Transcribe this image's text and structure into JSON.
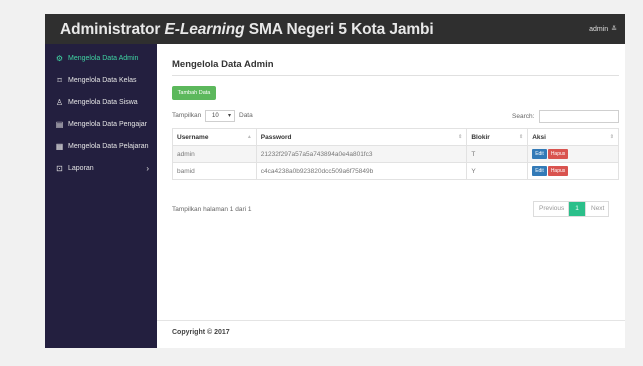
{
  "header": {
    "brand_part1": "Administrator",
    "brand_part2": "E-Learning",
    "brand_part3": "SMA Negeri 5 Kota Jambi",
    "user_label": "admin",
    "user_chevron": "≚"
  },
  "sidebar": {
    "items": [
      {
        "label": "Mengelola Data Admin",
        "icon": "settings-icon",
        "glyph": "⚙"
      },
      {
        "label": "Mengelola Data Kelas",
        "icon": "tag-icon",
        "glyph": "⌑"
      },
      {
        "label": "Mengelola Data Siswa",
        "icon": "user-icon",
        "glyph": "♙"
      },
      {
        "label": "Mengelola Data Pengajar",
        "icon": "id-card-icon",
        "glyph": "▤"
      },
      {
        "label": "Mengelola Data Pelajaran",
        "icon": "book-icon",
        "glyph": "▦"
      },
      {
        "label": "Laporan",
        "icon": "report-icon",
        "glyph": "⊡",
        "arrow": "›"
      }
    ],
    "active_color": "#3fd4a3"
  },
  "main": {
    "title": "Mengelola Data Admin",
    "add_button": "Tambah Data",
    "length_prefix": "Tampilkan",
    "length_value": "10",
    "length_suffix": "Data",
    "search_label": "Search:",
    "search_value": "",
    "table": {
      "columns": [
        "Username",
        "Password",
        "Blokir",
        "Aksi"
      ],
      "rows": [
        {
          "username": "admin",
          "password": "21232f297a57a5a743894a0e4a801fc3",
          "blokir": "T",
          "edit": "Edit",
          "hapus": "Hapus"
        },
        {
          "username": "bamid",
          "password": "c4ca4238a0b923820dcc509a6f75849b",
          "blokir": "Y",
          "edit": "Edit",
          "hapus": "Hapus"
        }
      ]
    },
    "info": "Tampilkan halaman 1 dari 1",
    "pager": {
      "previous": "Previous",
      "current": "1",
      "next": "Next"
    },
    "footer": "Copyright © 2017"
  },
  "colors": {
    "topbar": "#2f2f2f",
    "sidebar": "#231f3f",
    "add_button": "#5cb85c",
    "pager_active": "#2bbf8a",
    "edit": "#337ab7",
    "delete": "#d9534f"
  }
}
